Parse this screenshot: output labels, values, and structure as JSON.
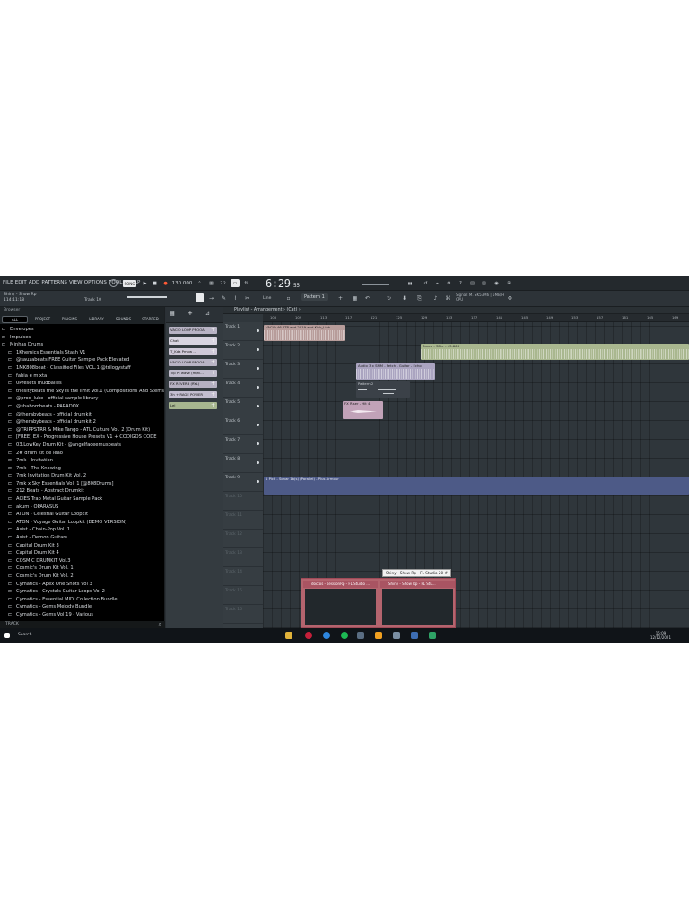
{
  "menu": [
    "FILE",
    "EDIT",
    "ADD",
    "PATTERNS",
    "VIEW",
    "OPTIONS",
    "TOOLS",
    "HELP"
  ],
  "toolbar": {
    "tempo": "130.000",
    "time_main": "6:29",
    "time_sub": ":55",
    "pattern": "Pattern 1",
    "song_title": "Shiny - Show Rp",
    "song_time": "114:11:18",
    "track_label": "Track 10",
    "mode": "Line",
    "cpu_info": "Signal: M. SK53M6 | 5MB/H",
    "cpu_label": "CPU"
  },
  "browser": {
    "header": "Browser",
    "tabs": [
      "ALL",
      "PROJECT",
      "PLUGINS",
      "LIBRARY",
      "SOUNDS",
      "STARRED"
    ],
    "items": [
      {
        "label": "Envelopes",
        "sub": false
      },
      {
        "label": "Impulses",
        "sub": false
      },
      {
        "label": "Minhas Drums",
        "sub": false
      },
      {
        "label": "1Khemics Essentials Stash V1",
        "sub": true
      },
      {
        "label": "@sauzabeats FREE Guitar Sample Pack Elevated",
        "sub": true
      },
      {
        "label": "1MK808beat - Classified Files VOL.1 @trilogystaff",
        "sub": true
      },
      {
        "label": "fabia e mixta",
        "sub": true
      },
      {
        "label": "0Presets mudballes",
        "sub": true
      },
      {
        "label": "thesitybeats the Sky is the limit Vol.1 (Compositions And Stems)",
        "sub": true
      },
      {
        "label": "@prod_luke - official sample library",
        "sub": true
      },
      {
        "label": "@shabombeats - PARADOX",
        "sub": true
      },
      {
        "label": "@therabybeats - official drumkit",
        "sub": true
      },
      {
        "label": "@therabybeats - official drumkit 2",
        "sub": true
      },
      {
        "label": "@TRIPPSTRR & Mike Tango - ATL Culture Vol. 2 (Drum Kit)",
        "sub": true
      },
      {
        "label": "[FREE] EX - Progressive House Presets V1 + CODIGOS CODE",
        "sub": true
      },
      {
        "label": "03.LowKey Drum Kit - @angelfaceemusbeats",
        "sub": true
      },
      {
        "label": "2# drum kit de leão",
        "sub": true
      },
      {
        "label": "7mk - Invitation",
        "sub": true
      },
      {
        "label": "7mk - The Knowing",
        "sub": true
      },
      {
        "label": "7mk Invitation Drum Kit Vol. 2",
        "sub": true
      },
      {
        "label": "7mk x Sky Essentials Vol. 1 [@808Drums]",
        "sub": true
      },
      {
        "label": "212 Beats - Abstract Drumkit",
        "sub": true
      },
      {
        "label": "ACIES Trap Metal Guitar Sample Pack",
        "sub": true
      },
      {
        "label": "akum - OPARASUS",
        "sub": true
      },
      {
        "label": "ATON - Celestial Guitar Loopkit",
        "sub": true
      },
      {
        "label": "ATON - Voyage Guitar Loopkit (DEMO VERSION)",
        "sub": true
      },
      {
        "label": "Axist - Chain-Pop Vol. 1",
        "sub": true
      },
      {
        "label": "Axist - Demon Guitars",
        "sub": true
      },
      {
        "label": "Capital Drum Kit 3",
        "sub": true
      },
      {
        "label": "Capital Drum Kit 4",
        "sub": true
      },
      {
        "label": "COSMIC DRUMKIT Vol.3",
        "sub": true
      },
      {
        "label": "Cosmic's Drum Kit Vol. 1",
        "sub": true
      },
      {
        "label": "Cosmic's Drum Kit Vol. 2",
        "sub": true
      },
      {
        "label": "Cymatics - Apex One Shots Vol 3",
        "sub": true
      },
      {
        "label": "Cymatics - Crystals Guitar Loops Vol 2",
        "sub": true
      },
      {
        "label": "Cymatics - Essential MIDI Collection Bundle",
        "sub": true
      },
      {
        "label": "Cymatics - Gems Melody Bundle",
        "sub": true
      },
      {
        "label": "Cymatics - Gems Vol 19 - Various",
        "sub": true
      }
    ],
    "footer": "TRACK"
  },
  "channels": [
    {
      "label": "VACIO LOOP PROOA",
      "color": "#b8b3c4"
    },
    {
      "label": "Chat",
      "color": "#d8d4e0"
    },
    {
      "label": "T_Kda Pmnw ...",
      "color": "#cfc9d8"
    },
    {
      "label": "VACIO LOOP PROOA",
      "color": "#b8b3c4"
    },
    {
      "label": "Tip Pt wave (m)hi...",
      "color": "#c0bccc"
    },
    {
      "label": "FX REVERB (RYL)",
      "color": "#b6b1c2"
    },
    {
      "label": "3h + RAGE POWER",
      "color": "#c3bed0"
    },
    {
      "label": "Lel",
      "color": "#a7b68f"
    }
  ],
  "playlist": {
    "title": "Playlist - Arrangement › (Cat) ›",
    "ruler": [
      "105",
      "109",
      "113",
      "117",
      "121",
      "125",
      "129",
      "133",
      "137",
      "141",
      "145",
      "149",
      "153",
      "157",
      "161",
      "165",
      "169"
    ],
    "tracks": [
      {
        "label": "Track 1",
        "active": true
      },
      {
        "label": "Track 2",
        "active": true
      },
      {
        "label": "Track 3",
        "active": true
      },
      {
        "label": "Track 4",
        "active": true
      },
      {
        "label": "Track 5",
        "active": true
      },
      {
        "label": "Track 6",
        "active": true
      },
      {
        "label": "Track 7",
        "active": true
      },
      {
        "label": "Track 8",
        "active": true
      },
      {
        "label": "Track 9",
        "active": true
      },
      {
        "label": "Track 10",
        "active": false
      },
      {
        "label": "Track 11",
        "active": false
      },
      {
        "label": "Track 12",
        "active": false
      },
      {
        "label": "Track 13",
        "active": false
      },
      {
        "label": "Track 14",
        "active": false
      },
      {
        "label": "Track 15",
        "active": false
      },
      {
        "label": "Track 16",
        "active": false
      }
    ],
    "clips": [
      {
        "label": "VACIO 46 ATP and 2019 and Kick_Link",
        "color": "#b79c9a"
      },
      {
        "label": "Breed - 3Bhr - 43.86K",
        "color": "#a9b78f"
      },
      {
        "label": "Audio 3 x SMM - Fetch - Guitar - Echo",
        "color": "#aaa4c0"
      },
      {
        "label": "Pattern 2",
        "color": "#3b4148"
      },
      {
        "label": "FX Riser - Hit 4",
        "color": "#c1a2b8"
      },
      {
        "label": "1 Pick - Sonar 1b(s) (Parallel) - Plus Armour",
        "color": "#4d5a87"
      }
    ]
  },
  "taskbar": {
    "thumb_tooltip": "Shiny - Show Rp - FL Studio 20 #",
    "thumbs": [
      "doctos - sessionRp - FL Studio ...",
      "Shiny - Show Rp - FL Stu..."
    ],
    "search": "Search",
    "time": "15:09",
    "date": "12/12/2021"
  }
}
